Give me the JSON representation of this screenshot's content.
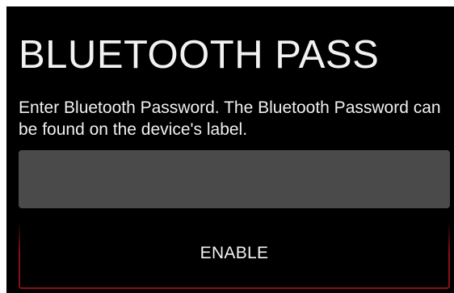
{
  "dialog": {
    "title": "BLUETOOTH PASS",
    "description": "Enter Bluetooth Password. The Bluetooth Password can be found on the device's label.",
    "password_input": {
      "value": "",
      "placeholder": ""
    },
    "enable_button_label": "ENABLE"
  },
  "colors": {
    "page_background": "#ffffff",
    "dialog_background": "#000000",
    "text": "#f2f2f2",
    "input_background": "#4a4a4a",
    "button_border": "#8e1111"
  }
}
